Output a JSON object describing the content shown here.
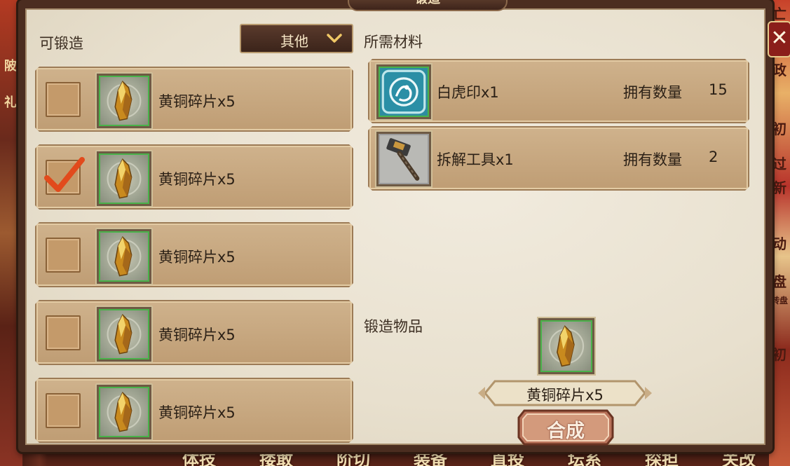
{
  "window": {
    "title": "锻造",
    "close_icon": "close-icon"
  },
  "background": {
    "bottom_tabs": [
      "体技",
      "搂敢",
      "阶切",
      "装备",
      "直投",
      "坛系",
      "探担",
      "关改"
    ],
    "right_side_text": [
      "亡",
      "政",
      "初",
      "过",
      "新",
      "动",
      "盘",
      "转盘",
      "初"
    ],
    "left_side_text": [
      "陂",
      "礼"
    ]
  },
  "left": {
    "section_label": "可锻造",
    "filter": {
      "selected": "其他",
      "icon": "chevron-down-icon"
    },
    "recipes": [
      {
        "name": "黄铜碎片x5",
        "checked": false,
        "icon": "bronze-shard-icon"
      },
      {
        "name": "黄铜碎片x5",
        "checked": true,
        "icon": "bronze-shard-icon"
      },
      {
        "name": "黄铜碎片x5",
        "checked": false,
        "icon": "bronze-shard-icon"
      },
      {
        "name": "黄铜碎片x5",
        "checked": false,
        "icon": "bronze-shard-icon"
      },
      {
        "name": "黄铜碎片x5",
        "checked": false,
        "icon": "bronze-shard-icon"
      }
    ]
  },
  "right": {
    "materials_label": "所需材料",
    "materials": [
      {
        "name": "白虎印x1",
        "owned_label": "拥有数量",
        "owned": "15",
        "icon": "white-tiger-seal-icon"
      },
      {
        "name": "拆解工具x1",
        "owned_label": "拥有数量",
        "owned": "2",
        "icon": "hammer-tool-icon"
      }
    ],
    "output_label": "锻造物品",
    "output": {
      "name": "黄铜碎片x5",
      "icon": "bronze-shard-icon"
    },
    "craft_button": "合成"
  },
  "colors": {
    "panel_bg": "#e8e0ce",
    "row_bg": "#c9a97f",
    "dropdown_bg": "#4a2f23",
    "accent_check": "#e24a1c",
    "craft_button": "#c98b6a"
  }
}
